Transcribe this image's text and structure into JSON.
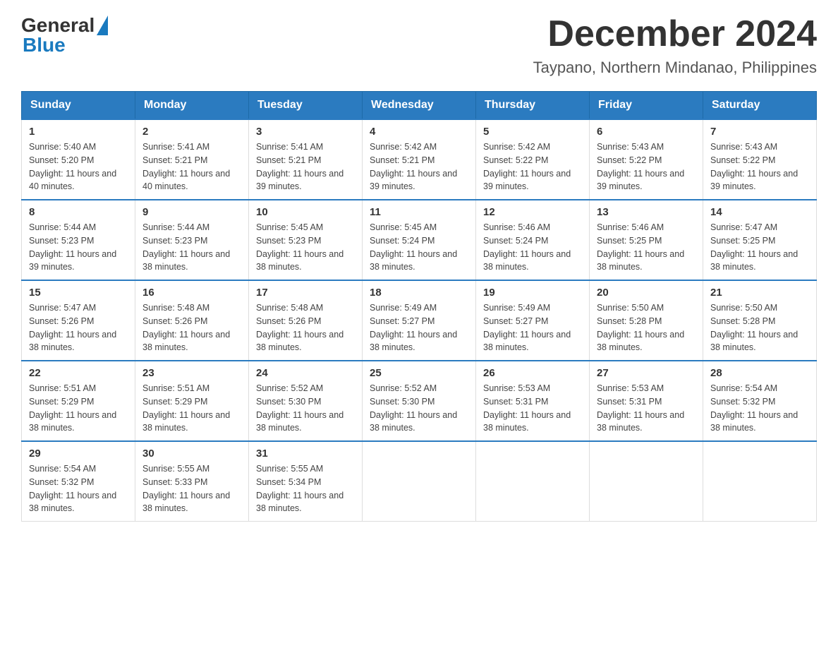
{
  "logo": {
    "general_text": "General",
    "blue_text": "Blue"
  },
  "title": {
    "month_year": "December 2024",
    "location": "Taypano, Northern Mindanao, Philippines"
  },
  "weekdays": [
    "Sunday",
    "Monday",
    "Tuesday",
    "Wednesday",
    "Thursday",
    "Friday",
    "Saturday"
  ],
  "weeks": [
    [
      {
        "day": "1",
        "sunrise": "5:40 AM",
        "sunset": "5:20 PM",
        "daylight": "11 hours and 40 minutes."
      },
      {
        "day": "2",
        "sunrise": "5:41 AM",
        "sunset": "5:21 PM",
        "daylight": "11 hours and 40 minutes."
      },
      {
        "day": "3",
        "sunrise": "5:41 AM",
        "sunset": "5:21 PM",
        "daylight": "11 hours and 39 minutes."
      },
      {
        "day": "4",
        "sunrise": "5:42 AM",
        "sunset": "5:21 PM",
        "daylight": "11 hours and 39 minutes."
      },
      {
        "day": "5",
        "sunrise": "5:42 AM",
        "sunset": "5:22 PM",
        "daylight": "11 hours and 39 minutes."
      },
      {
        "day": "6",
        "sunrise": "5:43 AM",
        "sunset": "5:22 PM",
        "daylight": "11 hours and 39 minutes."
      },
      {
        "day": "7",
        "sunrise": "5:43 AM",
        "sunset": "5:22 PM",
        "daylight": "11 hours and 39 minutes."
      }
    ],
    [
      {
        "day": "8",
        "sunrise": "5:44 AM",
        "sunset": "5:23 PM",
        "daylight": "11 hours and 39 minutes."
      },
      {
        "day": "9",
        "sunrise": "5:44 AM",
        "sunset": "5:23 PM",
        "daylight": "11 hours and 38 minutes."
      },
      {
        "day": "10",
        "sunrise": "5:45 AM",
        "sunset": "5:23 PM",
        "daylight": "11 hours and 38 minutes."
      },
      {
        "day": "11",
        "sunrise": "5:45 AM",
        "sunset": "5:24 PM",
        "daylight": "11 hours and 38 minutes."
      },
      {
        "day": "12",
        "sunrise": "5:46 AM",
        "sunset": "5:24 PM",
        "daylight": "11 hours and 38 minutes."
      },
      {
        "day": "13",
        "sunrise": "5:46 AM",
        "sunset": "5:25 PM",
        "daylight": "11 hours and 38 minutes."
      },
      {
        "day": "14",
        "sunrise": "5:47 AM",
        "sunset": "5:25 PM",
        "daylight": "11 hours and 38 minutes."
      }
    ],
    [
      {
        "day": "15",
        "sunrise": "5:47 AM",
        "sunset": "5:26 PM",
        "daylight": "11 hours and 38 minutes."
      },
      {
        "day": "16",
        "sunrise": "5:48 AM",
        "sunset": "5:26 PM",
        "daylight": "11 hours and 38 minutes."
      },
      {
        "day": "17",
        "sunrise": "5:48 AM",
        "sunset": "5:26 PM",
        "daylight": "11 hours and 38 minutes."
      },
      {
        "day": "18",
        "sunrise": "5:49 AM",
        "sunset": "5:27 PM",
        "daylight": "11 hours and 38 minutes."
      },
      {
        "day": "19",
        "sunrise": "5:49 AM",
        "sunset": "5:27 PM",
        "daylight": "11 hours and 38 minutes."
      },
      {
        "day": "20",
        "sunrise": "5:50 AM",
        "sunset": "5:28 PM",
        "daylight": "11 hours and 38 minutes."
      },
      {
        "day": "21",
        "sunrise": "5:50 AM",
        "sunset": "5:28 PM",
        "daylight": "11 hours and 38 minutes."
      }
    ],
    [
      {
        "day": "22",
        "sunrise": "5:51 AM",
        "sunset": "5:29 PM",
        "daylight": "11 hours and 38 minutes."
      },
      {
        "day": "23",
        "sunrise": "5:51 AM",
        "sunset": "5:29 PM",
        "daylight": "11 hours and 38 minutes."
      },
      {
        "day": "24",
        "sunrise": "5:52 AM",
        "sunset": "5:30 PM",
        "daylight": "11 hours and 38 minutes."
      },
      {
        "day": "25",
        "sunrise": "5:52 AM",
        "sunset": "5:30 PM",
        "daylight": "11 hours and 38 minutes."
      },
      {
        "day": "26",
        "sunrise": "5:53 AM",
        "sunset": "5:31 PM",
        "daylight": "11 hours and 38 minutes."
      },
      {
        "day": "27",
        "sunrise": "5:53 AM",
        "sunset": "5:31 PM",
        "daylight": "11 hours and 38 minutes."
      },
      {
        "day": "28",
        "sunrise": "5:54 AM",
        "sunset": "5:32 PM",
        "daylight": "11 hours and 38 minutes."
      }
    ],
    [
      {
        "day": "29",
        "sunrise": "5:54 AM",
        "sunset": "5:32 PM",
        "daylight": "11 hours and 38 minutes."
      },
      {
        "day": "30",
        "sunrise": "5:55 AM",
        "sunset": "5:33 PM",
        "daylight": "11 hours and 38 minutes."
      },
      {
        "day": "31",
        "sunrise": "5:55 AM",
        "sunset": "5:34 PM",
        "daylight": "11 hours and 38 minutes."
      },
      null,
      null,
      null,
      null
    ]
  ]
}
